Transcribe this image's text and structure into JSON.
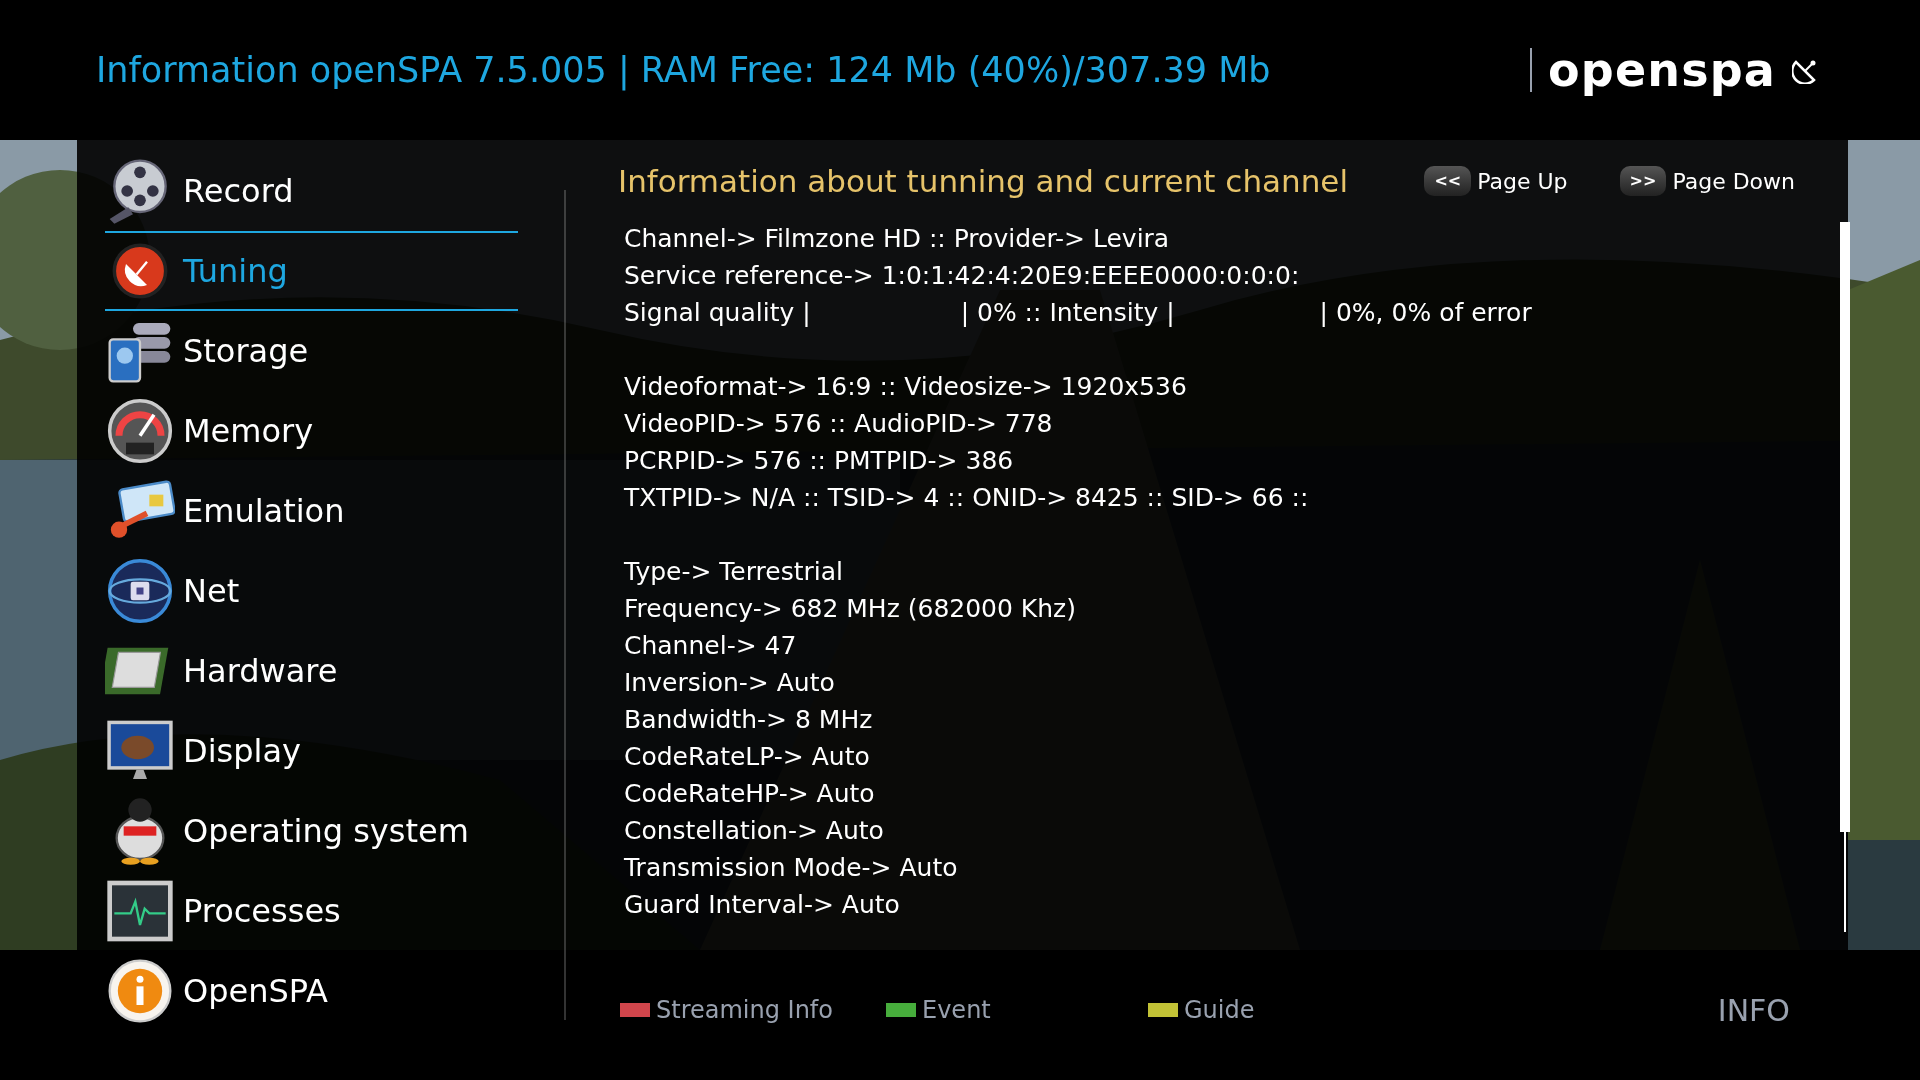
{
  "header": {
    "title": "Information openSPA 7.5.005 | RAM Free: 124 Mb (40%)/307.39 Mb",
    "logo": "openspa"
  },
  "menu": [
    {
      "label": "Record",
      "selected": false
    },
    {
      "label": "Tuning",
      "selected": true
    },
    {
      "label": "Storage",
      "selected": false
    },
    {
      "label": "Memory",
      "selected": false
    },
    {
      "label": "Emulation",
      "selected": false
    },
    {
      "label": "Net",
      "selected": false
    },
    {
      "label": "Hardware",
      "selected": false
    },
    {
      "label": "Display",
      "selected": false
    },
    {
      "label": "Operating system",
      "selected": false
    },
    {
      "label": "Processes",
      "selected": false
    },
    {
      "label": "OpenSPA",
      "selected": false
    }
  ],
  "content": {
    "title": "Information about tunning and current channel",
    "paging": [
      {
        "key": "<<",
        "label": "Page Up"
      },
      {
        "key": ">>",
        "label": "Page Down"
      }
    ],
    "lines": [
      {
        "kind": "text",
        "text": "Channel-> Filmzone HD :: Provider-> Levira"
      },
      {
        "kind": "text",
        "text": "Service reference-> 1:0:1:42:4:20E9:EEEE0000:0:0:0:"
      },
      {
        "kind": "signal",
        "parts": [
          "Signal quality |",
          "| 0% :: Intensity |",
          "| 0%, 0% of error"
        ]
      },
      {
        "kind": "blank"
      },
      {
        "kind": "text",
        "text": "Videoformat-> 16:9 :: Videosize-> 1920x536"
      },
      {
        "kind": "text",
        "text": "VideoPID-> 576 :: AudioPID-> 778"
      },
      {
        "kind": "text",
        "text": "PCRPID-> 576 :: PMTPID-> 386"
      },
      {
        "kind": "text",
        "text": "TXTPID-> N/A :: TSID-> 4 :: ONID-> 8425 :: SID-> 66 ::"
      },
      {
        "kind": "blank"
      },
      {
        "kind": "text",
        "text": "Type-> Terrestrial"
      },
      {
        "kind": "text",
        "text": "Frequency-> 682 MHz (682000 Khz)"
      },
      {
        "kind": "text",
        "text": "Channel-> 47"
      },
      {
        "kind": "text",
        "text": "Inversion-> Auto"
      },
      {
        "kind": "text",
        "text": "Bandwidth-> 8 MHz"
      },
      {
        "kind": "text",
        "text": "CodeRateLP-> Auto"
      },
      {
        "kind": "text",
        "text": "CodeRateHP-> Auto"
      },
      {
        "kind": "text",
        "text": "Constellation-> Auto"
      },
      {
        "kind": "text",
        "text": "Transmission Mode-> Auto"
      },
      {
        "kind": "text",
        "text": "Guard Interval-> Auto"
      }
    ]
  },
  "footer": {
    "keys": [
      {
        "label": "Streaming Info",
        "color": "#d0454b"
      },
      {
        "label": "Event",
        "color": "#47ad3c"
      },
      {
        "label": "Guide",
        "color": "#c2c236"
      }
    ],
    "info": "INFO"
  }
}
